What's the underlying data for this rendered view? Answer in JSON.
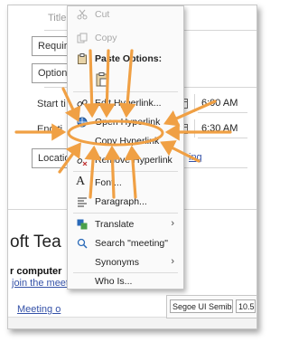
{
  "form": {
    "title_label": "Title",
    "required_label": "Requir",
    "optional_label": "Option",
    "start_label": "Start ti",
    "end_label": "End ti",
    "location_label": "Locatio",
    "start_time": "6:00 AM",
    "end_time": "6:30 AM",
    "room_finder_fragment": "ing"
  },
  "body_text": {
    "teams_fragment": "oft Tea",
    "computer_fragment": "r computer",
    "join_link": "join the meeting",
    "meeting_link": "Meeting o"
  },
  "context_menu": {
    "cut_label": "Cut",
    "copy_label": "Copy",
    "paste_options_label": "Paste Options:",
    "edit_hyperlink_label": "Edit Hyperlink...",
    "open_hyperlink_label": "Open Hyperlink",
    "copy_hyperlink_label": "Copy Hyperlink",
    "remove_hyperlink_label": "Remove Hyperlink",
    "font_label": "Font...",
    "paragraph_label": "Paragraph...",
    "translate_label": "Translate",
    "search_label": "Search \"meeting\"",
    "synonyms_label": "Synonyms",
    "who_is_label": "Who Is..."
  },
  "mini_toolbar": {
    "font_name": "Segoe UI Semibo",
    "font_size": "10.5"
  },
  "colors": {
    "annotation_arrow": "#f0a044",
    "annotation_ellipse": "#f0a044",
    "link": "#3552a8"
  }
}
